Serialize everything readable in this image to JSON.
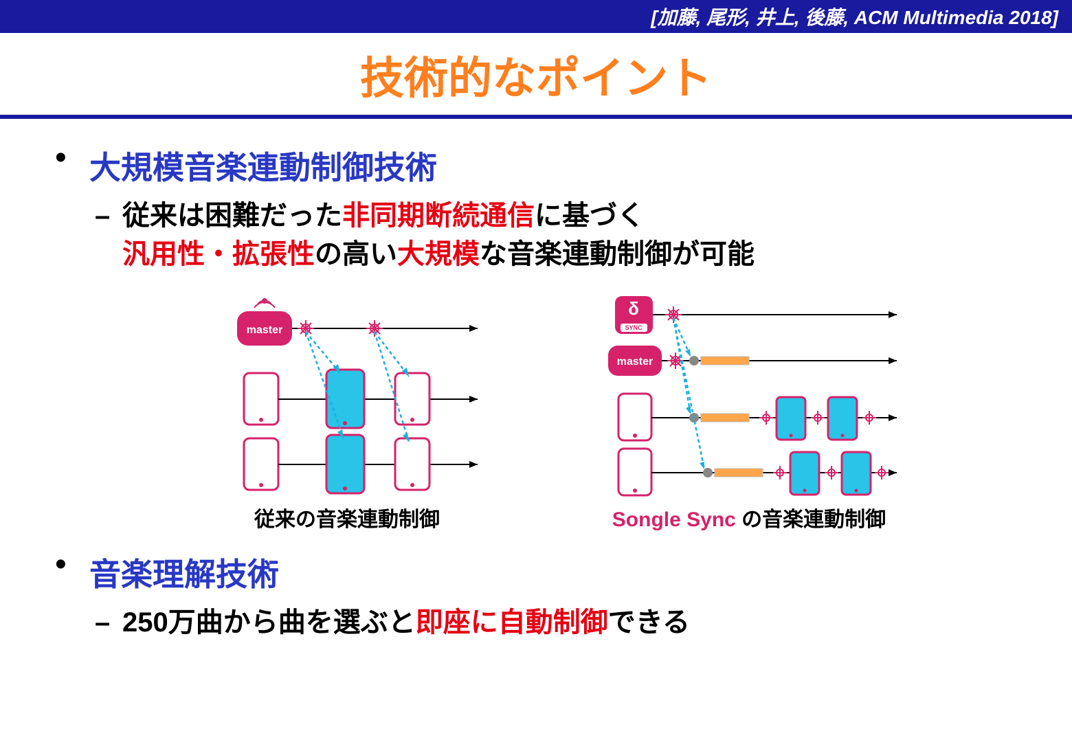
{
  "header": {
    "citation": "[加藤, 尾形, 井上, 後藤, ACM Multimedia 2018]"
  },
  "title": "技術的なポイント",
  "bullets": {
    "b1": {
      "heading": "大規模音楽連動制御技術",
      "sub": {
        "p1a": "従来は困難だった",
        "p1b": "非同期断続通信",
        "p1c": "に基づく",
        "p2a": "汎用性・拡張性",
        "p2b": "の高い",
        "p2c": "大規模",
        "p2d": "な音楽連動制御が可能"
      }
    },
    "b2": {
      "heading": "音楽理解技術",
      "sub": {
        "p1a": "250万曲から曲を選ぶと",
        "p1b": "即座に自動制御",
        "p1c": "できる"
      }
    }
  },
  "diagrams": {
    "left": {
      "masterLabel": "master",
      "caption": "従来の音楽連動制御"
    },
    "right": {
      "syncLabel": "SYNC",
      "masterLabel": "master",
      "captionPrefix": "Songle Sync",
      "captionSuffix": " の音楽連動制御"
    }
  }
}
